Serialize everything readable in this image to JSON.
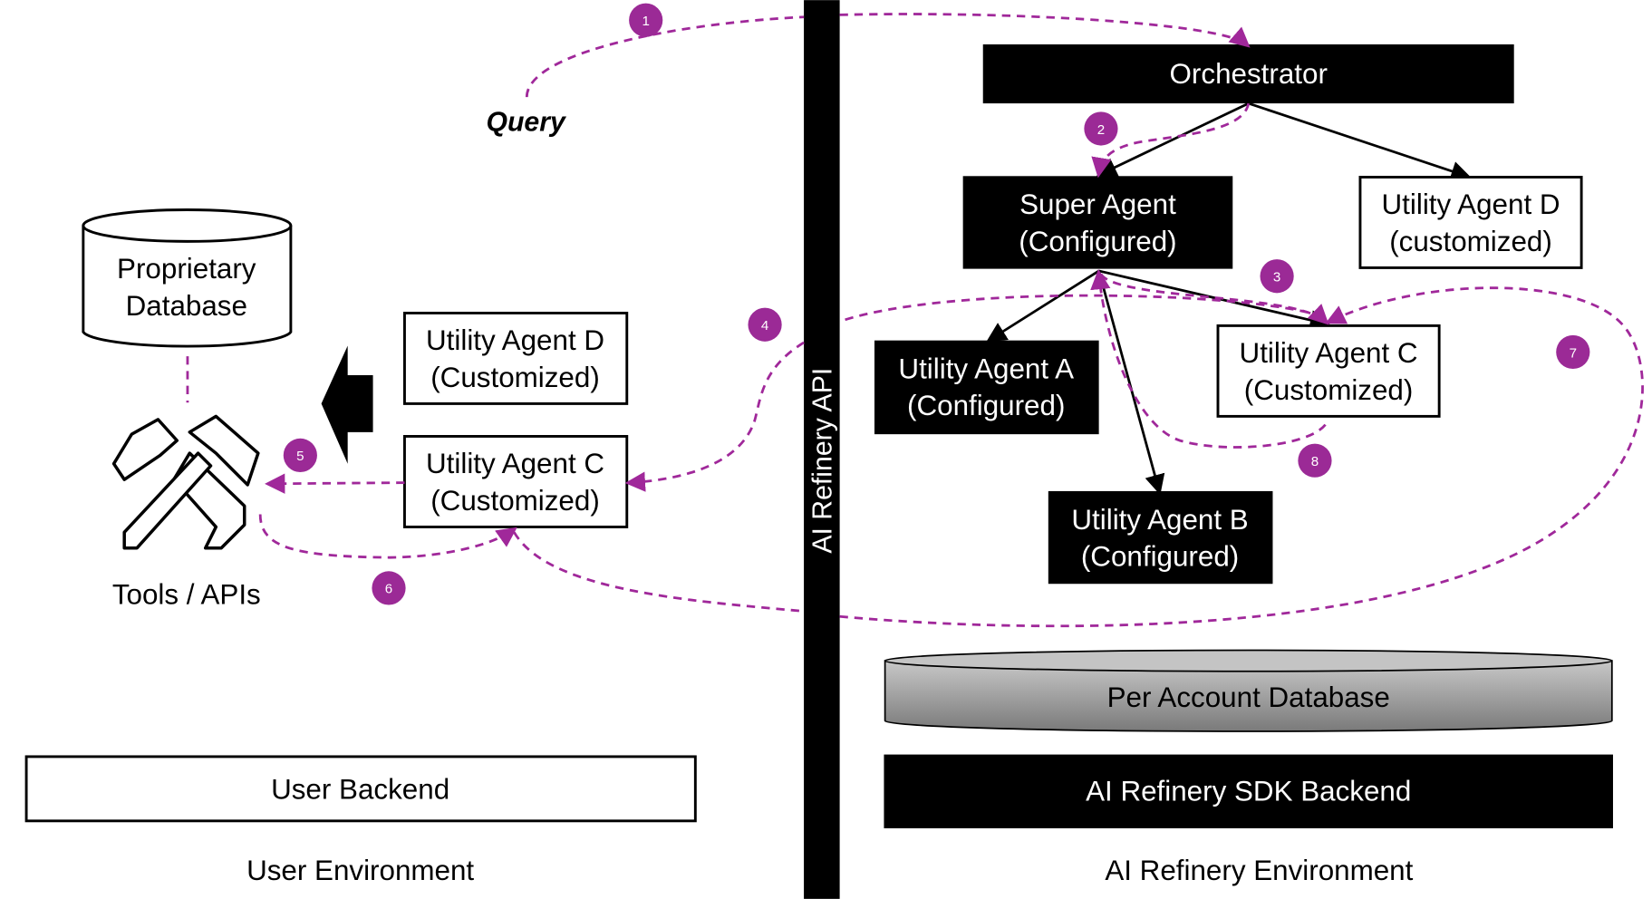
{
  "colors": {
    "flow": "#a0289a",
    "badge": "#9b2a96",
    "dark": "#000000",
    "db_gradient": [
      "#c8c8c8",
      "#7a7a7a"
    ]
  },
  "api_bar": {
    "label": "AI Refinery API"
  },
  "query": {
    "label": "Query"
  },
  "user_env": {
    "proprietary_db": {
      "line1": "Proprietary",
      "line2": "Database"
    },
    "agent_d": {
      "line1": "Utility Agent D",
      "line2": "(Customized)"
    },
    "agent_c": {
      "line1": "Utility Agent C",
      "line2": "(Customized)"
    },
    "tools": {
      "label": "Tools / APIs",
      "icon": "hammers-icon"
    },
    "backend": {
      "label": "User Backend"
    },
    "env_label": "User Environment"
  },
  "refinery_env": {
    "orchestrator": {
      "label": "Orchestrator"
    },
    "super_agent": {
      "line1": "Super Agent",
      "line2": "(Configured)"
    },
    "agent_d": {
      "line1": "Utility Agent D",
      "line2": "(customized)"
    },
    "agent_a": {
      "line1": "Utility Agent A",
      "line2": "(Configured)"
    },
    "agent_c": {
      "line1": "Utility Agent C",
      "line2": "(Customized)"
    },
    "agent_b": {
      "line1": "Utility Agent B",
      "line2": "(Configured)"
    },
    "account_db": {
      "label": "Per Account Database"
    },
    "sdk_backend": {
      "label": "AI Refinery SDK Backend"
    },
    "env_label": "AI Refinery Environment"
  },
  "steps": [
    "1",
    "2",
    "3",
    "4",
    "5",
    "6",
    "7",
    "8"
  ]
}
